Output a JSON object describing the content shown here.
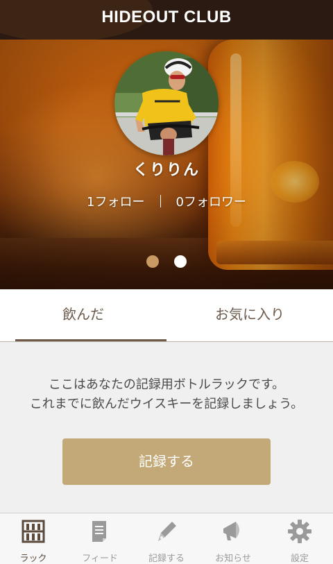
{
  "header": {
    "title": "HIDEOUT CLUB"
  },
  "profile": {
    "name": "くりりん",
    "following": "1フォロー",
    "followers": "0フォロワー"
  },
  "carousel": {
    "active_page": 2,
    "pages": 2
  },
  "tabs": [
    {
      "label": "飲んだ",
      "active": true
    },
    {
      "label": "お気に入り",
      "active": false
    }
  ],
  "content": {
    "message_line1": "ここはあなたの記録用ボトルラックです。",
    "message_line2": "これまでに飲んだウイスキーを記録しましょう。",
    "record_button": "記録する"
  },
  "bottom_nav": [
    {
      "label": "ラック",
      "icon": "rack-icon",
      "active": true
    },
    {
      "label": "フィード",
      "icon": "feed-icon",
      "active": false
    },
    {
      "label": "記録する",
      "icon": "pen-icon",
      "active": false
    },
    {
      "label": "お知らせ",
      "icon": "megaphone-icon",
      "active": false
    },
    {
      "label": "設定",
      "icon": "gear-icon",
      "active": false
    }
  ],
  "colors": {
    "header_bg": "#2a1a12",
    "accent_brown": "#6e5a49",
    "button_gold": "#c2a977",
    "nav_active": "#5b4a3c",
    "nav_inactive": "#9a9a9a"
  }
}
